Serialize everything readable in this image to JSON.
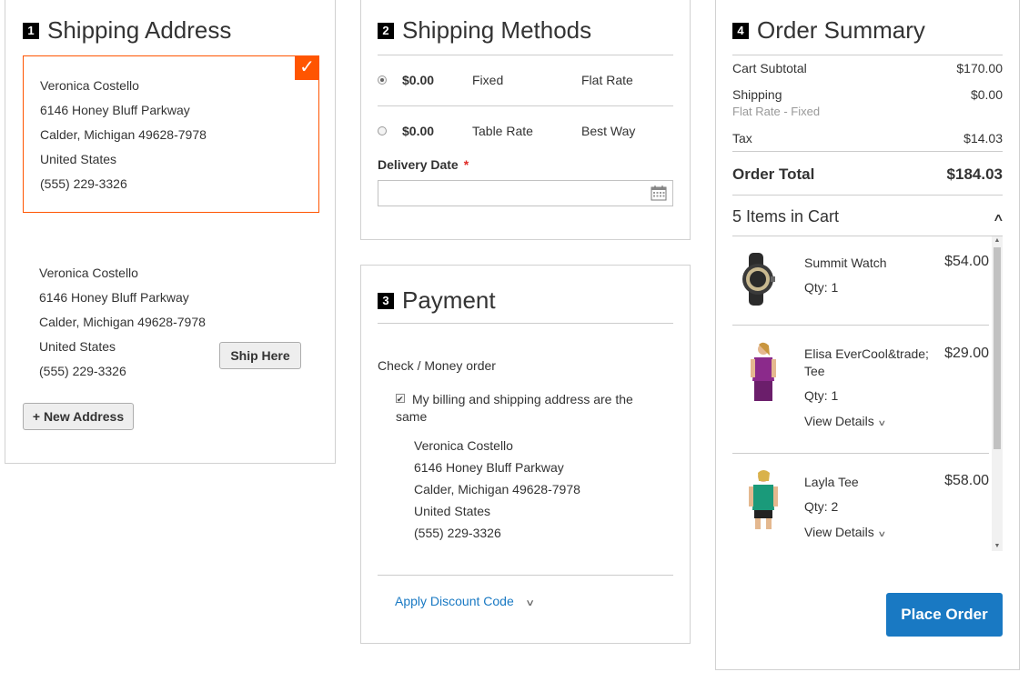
{
  "shipping_address": {
    "step_number": "1",
    "title": "Shipping Address",
    "selected": {
      "name": "Veronica Costello",
      "street": "6146 Honey Bluff Parkway",
      "city_line": "Calder, Michigan 49628-7978",
      "country": "United States",
      "phone": "(555) 229-3326"
    },
    "other": {
      "name": "Veronica Costello",
      "street": "6146 Honey Bluff Parkway",
      "city_line": "Calder, Michigan 49628-7978",
      "country": "United States",
      "phone": "(555) 229-3326"
    },
    "ship_here_label": "Ship Here",
    "new_address_plus": "+",
    "new_address_label": "New Address"
  },
  "shipping_methods": {
    "step_number": "2",
    "title": "Shipping Methods",
    "methods": [
      {
        "price": "$0.00",
        "method": "Fixed",
        "carrier": "Flat Rate",
        "selected": true
      },
      {
        "price": "$0.00",
        "method": "Table Rate",
        "carrier": "Best Way",
        "selected": false
      }
    ],
    "delivery_date_label": "Delivery Date",
    "required_mark": "*",
    "delivery_date_value": ""
  },
  "payment": {
    "step_number": "3",
    "title": "Payment",
    "method_label": "Check / Money order",
    "billing_same_label": "My billing and shipping address are the same",
    "billing_same_checked": true,
    "billing": {
      "name": "Veronica Costello",
      "street": "6146 Honey Bluff Parkway",
      "city_line": "Calder, Michigan 49628-7978",
      "country": "United States",
      "phone": "(555) 229-3326"
    },
    "discount_label": "Apply Discount Code"
  },
  "order_summary": {
    "step_number": "4",
    "title": "Order Summary",
    "cart_subtotal_label": "Cart Subtotal",
    "cart_subtotal": "$170.00",
    "shipping_label": "Shipping",
    "shipping_value": "$0.00",
    "shipping_method": "Flat Rate - Fixed",
    "tax_label": "Tax",
    "tax_value": "$14.03",
    "total_label": "Order Total",
    "total_value": "$184.03",
    "items_in_cart": "5 Items in Cart",
    "items": [
      {
        "name": "Summit Watch",
        "price": "$54.00",
        "qty": "Qty: 1",
        "view_details": ""
      },
      {
        "name": "Elisa EverCool&trade; Tee",
        "price": "$29.00",
        "qty": "Qty: 1",
        "view_details": "View Details"
      },
      {
        "name": "Layla Tee",
        "price": "$58.00",
        "qty": "Qty: 2",
        "view_details": "View Details"
      }
    ],
    "place_order_label": "Place Order"
  },
  "colors": {
    "accent_orange": "#ff5501",
    "primary_blue": "#1979c3",
    "required_red": "#e02b27"
  }
}
